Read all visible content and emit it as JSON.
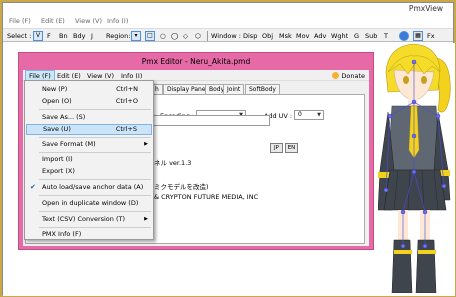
{
  "pmxview": {
    "title": "PmxView",
    "menus": [
      "File (F)",
      "Edit (E)",
      "View (V)",
      "Info (I)"
    ],
    "toolbar": {
      "select_label": "Select :",
      "select_items": [
        "V",
        "F",
        "Bn",
        "Bdy",
        "J"
      ],
      "region_label": "Region:",
      "window_label": "Window :",
      "window_items": [
        "Disp",
        "Obj",
        "Msk",
        "Mov",
        "Adv",
        "Wght",
        "G",
        "Sub",
        "T"
      ],
      "fx_label": "Fx"
    }
  },
  "editor": {
    "title": "Pmx Editor - Neru_Akita.pmd",
    "menus": [
      "File (F)",
      "Edit (E)",
      "View (V)",
      "Info (I)"
    ],
    "donate_label": "Donate",
    "tabs": [
      "h",
      "Display Pane",
      "Body",
      "Joint",
      "SoftBody"
    ],
    "encoding_label": "Encoding :",
    "add_uv_label": "Add UV :",
    "add_uv_value": "0",
    "jp_button": "JP",
    "en_button": "EN",
    "comment_lines": [
      "ネル ver.1.3",
      "",
      "",
      "ミクモデルを改造)",
      "&  CRYPTON FUTURE MEDIA, INC"
    ]
  },
  "file_menu": {
    "items": [
      {
        "label": "New (P)",
        "shortcut": "Ctrl+N"
      },
      {
        "label": "Open (O)",
        "shortcut": "Ctrl+O"
      },
      {
        "label": "Save As... (S)",
        "shortcut": ""
      },
      {
        "label": "Save (U)",
        "shortcut": "Ctrl+S"
      },
      {
        "label": "Save Format (M)",
        "shortcut": ""
      },
      {
        "label": "Import (I)",
        "shortcut": ""
      },
      {
        "label": "Export (X)",
        "shortcut": ""
      },
      {
        "label": "Auto load/save anchor data (A)",
        "shortcut": ""
      },
      {
        "label": "Open in duplicate window (D)",
        "shortcut": ""
      },
      {
        "label": "Text (CSV) Conversion (T)",
        "shortcut": ""
      },
      {
        "label": "PMX Info (F)",
        "shortcut": ""
      }
    ]
  },
  "colors": {
    "editor_frame": "#e66aa5",
    "highlight": "#cce4f7",
    "check": "#1a5fb4"
  }
}
